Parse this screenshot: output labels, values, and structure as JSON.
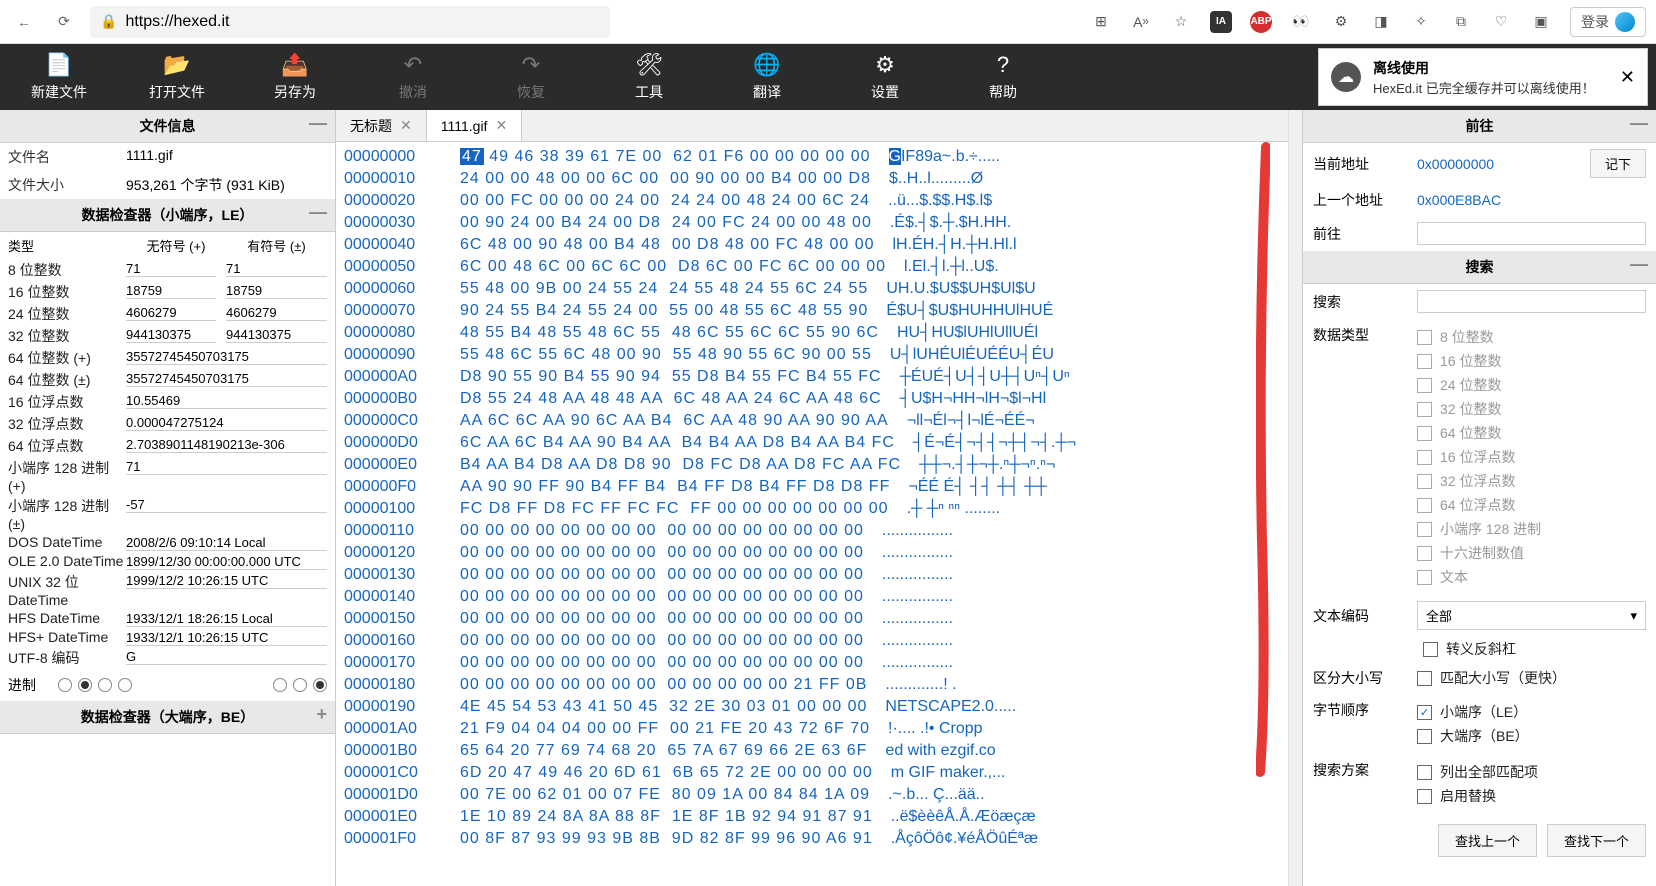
{
  "browser": {
    "url": "https://hexed.it",
    "login": "登录"
  },
  "toolbar": [
    {
      "icon": "file-new",
      "label": "新建文件",
      "enabled": true
    },
    {
      "icon": "folder-open",
      "label": "打开文件",
      "enabled": true
    },
    {
      "icon": "export",
      "label": "另存为",
      "enabled": true
    },
    {
      "icon": "undo",
      "label": "撤消",
      "enabled": false
    },
    {
      "icon": "redo",
      "label": "恢复",
      "enabled": false
    },
    {
      "icon": "tools",
      "label": "工具",
      "enabled": true
    },
    {
      "icon": "translate",
      "label": "翻译",
      "enabled": true
    },
    {
      "icon": "settings",
      "label": "设置",
      "enabled": true
    },
    {
      "icon": "help",
      "label": "帮助",
      "enabled": true
    }
  ],
  "notify": {
    "title": "离线使用",
    "body": "HexEd.it 已完全缓存并可以离线使用！"
  },
  "file_info": {
    "header": "文件信息",
    "filename_label": "文件名",
    "filename": "1111.gif",
    "filesize_label": "文件大小",
    "filesize": "953,261 个字节 (931 KiB)"
  },
  "data_inspector_le": {
    "header": "数据检查器（小端序，LE）",
    "col_type": "类型",
    "col_unsigned": "无符号 (+)",
    "col_signed": "有符号 (±)",
    "rows_dual": [
      {
        "t": "8 位整数",
        "u": "71",
        "s": "71"
      },
      {
        "t": "16 位整数",
        "u": "18759",
        "s": "18759"
      },
      {
        "t": "24 位整数",
        "u": "4606279",
        "s": "4606279"
      },
      {
        "t": "32 位整数",
        "u": "944130375",
        "s": "944130375"
      }
    ],
    "rows_single": [
      {
        "t": "64 位整数 (+)",
        "v": "35572745450703175"
      },
      {
        "t": "64 位整数 (±)",
        "v": "35572745450703175"
      },
      {
        "t": "16 位浮点数",
        "v": "10.55469"
      },
      {
        "t": "32 位浮点数",
        "v": "0.000047275124"
      },
      {
        "t": "64 位浮点数",
        "v": "2.7038901148190213e-306"
      },
      {
        "t": "小端序 128 进制 (+)",
        "v": "71"
      },
      {
        "t": "小端序 128 进制 (±)",
        "v": "-57"
      },
      {
        "t": "DOS DateTime",
        "v": "2008/2/6 09:10:14 Local"
      },
      {
        "t": "OLE 2.0 DateTime",
        "v": "1899/12/30 00:00:00.000 UTC"
      },
      {
        "t": "UNIX 32 位 DateTime",
        "v": "1999/12/2 10:26:15 UTC"
      },
      {
        "t": "HFS DateTime",
        "v": "1933/12/1 18:26:15 Local"
      },
      {
        "t": "HFS+ DateTime",
        "v": "1933/12/1 10:26:15 UTC"
      },
      {
        "t": "UTF-8 编码",
        "v": "G"
      }
    ],
    "radix_label": "进制"
  },
  "data_inspector_be": {
    "header": "数据检查器（大端序，BE）"
  },
  "tabs": [
    {
      "label": "无标题",
      "active": false,
      "closable": true
    },
    {
      "label": "1111.gif",
      "active": true,
      "closable": true
    }
  ],
  "hex": {
    "rows": [
      {
        "off": "00000000",
        "b": "47 49 46 38 39 61 7E 00  62 01 F6 00 00 00 00 00",
        "a": "GIF89a~.b.÷....."
      },
      {
        "off": "00000010",
        "b": "24 00 00 48 00 00 6C 00  00 90 00 00 B4 00 00 D8",
        "a": "$..H..l.........Ø"
      },
      {
        "off": "00000020",
        "b": "00 00 FC 00 00 00 24 00  24 24 00 48 24 00 6C 24",
        "a": "..ü...$.$$.H$.l$"
      },
      {
        "off": "00000030",
        "b": "00 90 24 00 B4 24 00 D8  24 00 FC 24 00 00 48 00",
        "a": ".É$.┤$.┼.$H.HH."
      },
      {
        "off": "00000040",
        "b": "6C 48 00 90 48 00 B4 48  00 D8 48 00 FC 48 00 00",
        "a": "lH.ÉH.┤H.┼H.Hl.l"
      },
      {
        "off": "00000050",
        "b": "6C 00 48 6C 00 6C 6C 00  D8 6C 00 FC 6C 00 00 00",
        "a": "l.El.┤l.┼l..U$."
      },
      {
        "off": "00000060",
        "b": "55 48 00 9B 00 24 55 24  24 55 48 24 55 6C 24 55",
        "a": "UH.U.$U$$UH$Ul$U"
      },
      {
        "off": "00000070",
        "b": "90 24 55 B4 24 55 24 00  55 00 48 55 6C 48 55 90",
        "a": "É$U┤$U$HUHHUlHUÉ"
      },
      {
        "off": "00000080",
        "b": "48 55 B4 48 55 48 6C 55  48 6C 55 6C 6C 55 90 6C",
        "a": "HU┤HU$lUHlUllUÉl"
      },
      {
        "off": "00000090",
        "b": "55 48 6C 55 6C 48 00 90  55 48 90 55 6C 90 00 55",
        "a": "U┤lUHÉUlÉUÉÉU┤ÉU"
      },
      {
        "off": "000000A0",
        "b": "D8 90 55 90 B4 55 90 94  55 D8 B4 55 FC B4 55 FC",
        "a": "┼ÉUÉ┤U┤┤U┼┤Uⁿ┤Uⁿ"
      },
      {
        "off": "000000B0",
        "b": "D8 55 24 48 AA 48 48 AA  6C 48 AA 24 6C AA 48 6C",
        "a": "┤U$H¬HH¬lH¬$l¬Hl"
      },
      {
        "off": "000000C0",
        "b": "AA 6C 6C AA 90 6C AA B4  6C AA 48 90 AA 90 90 AA",
        "a": "¬ll¬Él¬┤l¬lÉ¬ÉÉ¬"
      },
      {
        "off": "000000D0",
        "b": "6C AA 6C B4 AA 90 B4 AA  B4 B4 AA D8 B4 AA B4 FC",
        "a": "┤É¬É┤¬┤┤¬┼┤¬┤.┼¬"
      },
      {
        "off": "000000E0",
        "b": "B4 AA B4 D8 AA D8 D8 90  D8 FC D8 AA D8 FC AA FC",
        "a": "┼┼¬.┤┼¬┼.ⁿ┼¬ⁿ.ⁿ¬"
      },
      {
        "off": "000000F0",
        "b": "AA 90 90 FF 90 B4 FF B4  B4 FF D8 B4 FF D8 D8 FF",
        "a": "¬ÉÉ É┤ ┤┤ ┼┤ ┼┼ "
      },
      {
        "off": "00000100",
        "b": "FC D8 FF D8 FC FF FC FC  FF 00 00 00 00 00 00 00",
        "a": ".┼ ┼ⁿ ⁿⁿ ........"
      },
      {
        "off": "00000110",
        "b": "00 00 00 00 00 00 00 00  00 00 00 00 00 00 00 00",
        "a": "................"
      },
      {
        "off": "00000120",
        "b": "00 00 00 00 00 00 00 00  00 00 00 00 00 00 00 00",
        "a": "................"
      },
      {
        "off": "00000130",
        "b": "00 00 00 00 00 00 00 00  00 00 00 00 00 00 00 00",
        "a": "................"
      },
      {
        "off": "00000140",
        "b": "00 00 00 00 00 00 00 00  00 00 00 00 00 00 00 00",
        "a": "................"
      },
      {
        "off": "00000150",
        "b": "00 00 00 00 00 00 00 00  00 00 00 00 00 00 00 00",
        "a": "................"
      },
      {
        "off": "00000160",
        "b": "00 00 00 00 00 00 00 00  00 00 00 00 00 00 00 00",
        "a": "................"
      },
      {
        "off": "00000170",
        "b": "00 00 00 00 00 00 00 00  00 00 00 00 00 00 00 00",
        "a": "................"
      },
      {
        "off": "00000180",
        "b": "00 00 00 00 00 00 00 00  00 00 00 00 00 21 FF 0B",
        "a": ".............! ."
      },
      {
        "off": "00000190",
        "b": "4E 45 54 53 43 41 50 45  32 2E 30 03 01 00 00 00",
        "a": "NETSCAPE2.0....."
      },
      {
        "off": "000001A0",
        "b": "21 F9 04 04 04 00 00 FF  00 21 FE 20 43 72 6F 70",
        "a": "!·.... .!• Cropp"
      },
      {
        "off": "000001B0",
        "b": "65 64 20 77 69 74 68 20  65 7A 67 69 66 2E 63 6F",
        "a": "ed with ezgif.co"
      },
      {
        "off": "000001C0",
        "b": "6D 20 47 49 46 20 6D 61  6B 65 72 2E 00 00 00 00",
        "a": "m GIF maker.,..."
      },
      {
        "off": "000001D0",
        "b": "00 7E 00 62 01 00 07 FE  80 09 1A 00 84 84 1A 09",
        "a": ".~.b... Ç...ää.."
      },
      {
        "off": "000001E0",
        "b": "1E 10 89 24 8A 8A 88 8F  1E 8F 1B 92 94 91 87 91",
        "a": "..ë$èèêÅ.Å.Æöæçæ"
      },
      {
        "off": "000001F0",
        "b": "00 8F 87 93 99 93 9B 8B  9D 82 8F 99 96 90 A6 91",
        "a": ".ÅçôÖô¢.¥éÅÖûÉªæ"
      }
    ]
  },
  "goto": {
    "header": "前往",
    "cur_label": "当前地址",
    "cur_value": "0x00000000",
    "remember": "记下",
    "prev_label": "上一个地址",
    "prev_value": "0x000E8BAC",
    "goto_label": "前往"
  },
  "search": {
    "header": "搜索",
    "search_label": "搜索",
    "datatype_label": "数据类型",
    "types": [
      "8 位整数",
      "16 位整数",
      "24 位整数",
      "32 位整数",
      "64 位整数",
      "16 位浮点数",
      "32 位浮点数",
      "64 位浮点数",
      "小端序 128 进制",
      "十六进制数值",
      "文本"
    ],
    "text_enc_label": "文本编码",
    "text_enc_value": "全部",
    "escape": "转义反斜杠",
    "case_label": "区分大小写",
    "case_opt": "匹配大小写（更快）",
    "byteorder_label": "字节顺序",
    "le": "小端序（LE）",
    "be": "大端序（BE）",
    "scheme_label": "搜索方案",
    "list_all": "列出全部匹配项",
    "enable_replace": "启用替换",
    "find_prev": "查找上一个",
    "find_next": "查找下一个"
  }
}
